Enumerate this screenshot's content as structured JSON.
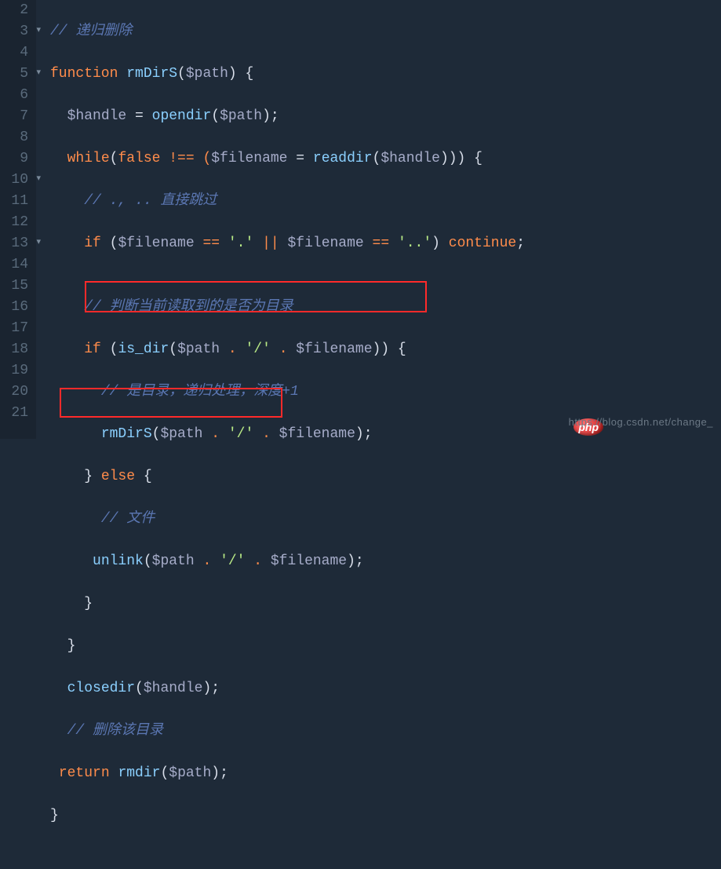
{
  "gutter": {
    "lines": [
      {
        "n": "2",
        "fold": ""
      },
      {
        "n": "3",
        "fold": "▾"
      },
      {
        "n": "4",
        "fold": ""
      },
      {
        "n": "5",
        "fold": "▾"
      },
      {
        "n": "6",
        "fold": ""
      },
      {
        "n": "7",
        "fold": ""
      },
      {
        "n": "8",
        "fold": ""
      },
      {
        "n": "9",
        "fold": ""
      },
      {
        "n": "10",
        "fold": "▾"
      },
      {
        "n": "11",
        "fold": ""
      },
      {
        "n": "12",
        "fold": ""
      },
      {
        "n": "13",
        "fold": "▾"
      },
      {
        "n": "14",
        "fold": ""
      },
      {
        "n": "15",
        "fold": ""
      },
      {
        "n": "16",
        "fold": ""
      },
      {
        "n": "17",
        "fold": ""
      },
      {
        "n": "18",
        "fold": ""
      },
      {
        "n": "19",
        "fold": ""
      },
      {
        "n": "20",
        "fold": ""
      },
      {
        "n": "21",
        "fold": ""
      }
    ]
  },
  "code": {
    "l2": {
      "cmt": "// 递归删除"
    },
    "l3": {
      "kw1": "function",
      "sp": " ",
      "fn": "rmDirS",
      "p1": "(",
      "var": "$path",
      "p2": ") {"
    },
    "l4": {
      "pre": "  ",
      "var1": "$handle",
      "eq": " = ",
      "fn": "opendir",
      "p1": "(",
      "var2": "$path",
      "p2": ");"
    },
    "l5": {
      "pre": "  ",
      "kw": "while",
      "p1": "(",
      "kw2": "false",
      " op": " !== (",
      "var1": "$filename",
      "eq": " = ",
      "fn": "readdir",
      "p2": "(",
      "var2": "$handle",
      "p3": "))) {"
    },
    "l6": {
      "pre": "    ",
      "cmt": "// ., .. 直接跳过"
    },
    "l7": {
      "pre": "    ",
      "kw": "if ",
      "p1": "(",
      "var1": "$filename",
      "op1": " == ",
      "s1": "'.'",
      "op2": " || ",
      "var2": "$filename",
      "op3": " == ",
      "s2": "'..'",
      "p2": ") ",
      "kw2": "continue",
      "p3": ";"
    },
    "l8": {
      "pre": ""
    },
    "l9": {
      "pre": "    ",
      "cmt": "// 判断当前读取到的是否为目录"
    },
    "l10": {
      "pre": "    ",
      "kw": "if ",
      "p1": "(",
      "fn": "is_dir",
      "p2": "(",
      "var1": "$path",
      "op1": " . ",
      "s1": "'/'",
      "op2": " . ",
      "var2": "$filename",
      "p3": ")) {"
    },
    "l11": {
      "pre": "      ",
      "cmt": "// 是目录，递归处理，深度+1"
    },
    "l12": {
      "pre": "      ",
      "fn": "rmDirS",
      "p1": "(",
      "var1": "$path",
      "op1": " . ",
      "s1": "'/'",
      "op2": " . ",
      "var2": "$filename",
      "p2": ");"
    },
    "l13": {
      "pre": "    ",
      "p1": "} ",
      "kw": "else",
      "p2": " {"
    },
    "l14": {
      "pre": "      ",
      "cmt": "// 文件"
    },
    "l15": {
      "pre": "     ",
      "fn": "unlink",
      "p1": "(",
      "var1": "$path",
      "op1": " . ",
      "s1": "'/'",
      "op2": " . ",
      "var2": "$filename",
      "p2": ");"
    },
    "l16": {
      "pre": "    ",
      "p": "}"
    },
    "l17": {
      "pre": "  ",
      "p": "}"
    },
    "l18": {
      "pre": "  ",
      "fn": "closedir",
      "p1": "(",
      "var": "$handle",
      "p2": ");"
    },
    "l19": {
      "pre": "  ",
      "cmt": "// 删除该目录"
    },
    "l20": {
      "pre": " ",
      "kw": "return ",
      "fn": "rmdir",
      "p1": "(",
      "var": "$path",
      "p2": ");"
    },
    "l21": {
      "p": "}"
    }
  },
  "watermark": "https://blog.csdn.net/change_",
  "badge": "php"
}
